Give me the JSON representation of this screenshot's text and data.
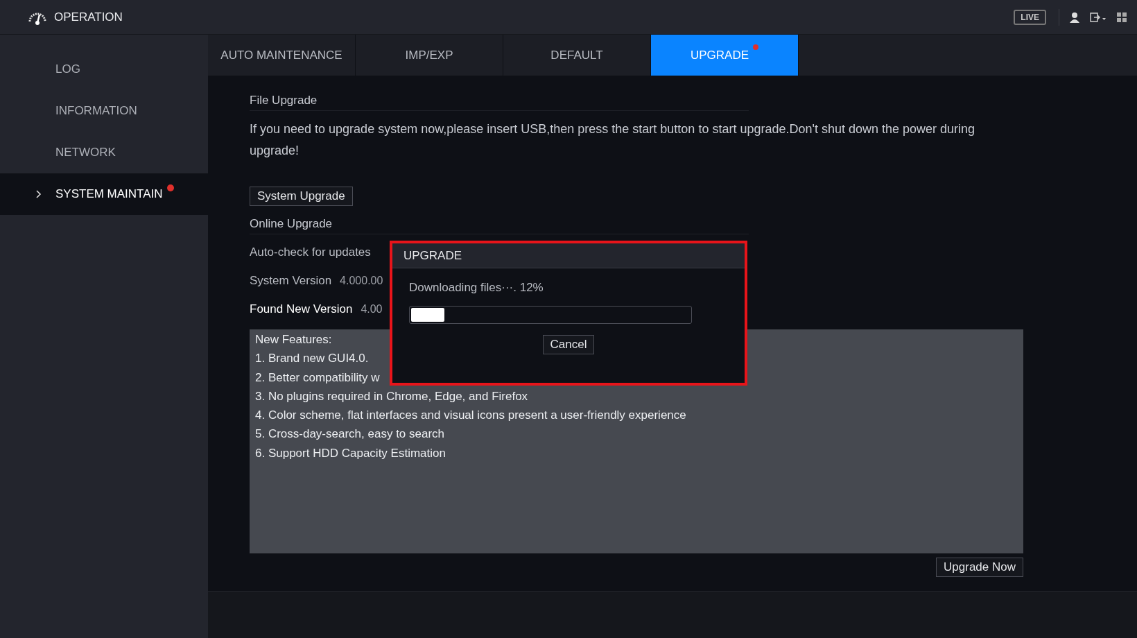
{
  "header": {
    "title": "OPERATION",
    "live_button": "LIVE"
  },
  "sidebar": {
    "items": [
      {
        "label": "LOG",
        "selected": false,
        "alert": false
      },
      {
        "label": "INFORMATION",
        "selected": false,
        "alert": false
      },
      {
        "label": "NETWORK",
        "selected": false,
        "alert": false
      },
      {
        "label": "SYSTEM MAINTAIN",
        "selected": true,
        "alert": true
      }
    ]
  },
  "tabs": [
    {
      "label": "AUTO MAINTENANCE",
      "selected": false,
      "alert": false
    },
    {
      "label": "IMP/EXP",
      "selected": false,
      "alert": false
    },
    {
      "label": "DEFAULT",
      "selected": false,
      "alert": false
    },
    {
      "label": "UPGRADE",
      "selected": true,
      "alert": true
    }
  ],
  "file_upgrade": {
    "title": "File Upgrade",
    "notice": "If you need to upgrade system now,please insert USB,then press the start button to start upgrade.Don't shut down the power during upgrade!",
    "button": "System Upgrade"
  },
  "online_upgrade": {
    "title": "Online Upgrade",
    "rows": [
      {
        "label": "Auto-check for updates",
        "value": ""
      },
      {
        "label": "System Version",
        "value": "4.000.00"
      },
      {
        "label": "Found New Version",
        "value": "4.00",
        "emphasis": true
      }
    ]
  },
  "features": [
    "New Features:",
    "1. Brand new GUI4.0.",
    "2. Better compatibility w",
    "3.  No plugins required in Chrome, Edge, and Firefox",
    "4. Color scheme, flat interfaces and visual icons present a user-friendly experience",
    "5. Cross-day-search, easy to search",
    "6. Support HDD Capacity Estimation"
  ],
  "upgrade_now_button": "Upgrade Now",
  "dialog": {
    "title": "UPGRADE",
    "message": "Downloading files···. 12%",
    "progress": {
      "level": 0.12
    },
    "cancel_button": "Cancel"
  }
}
